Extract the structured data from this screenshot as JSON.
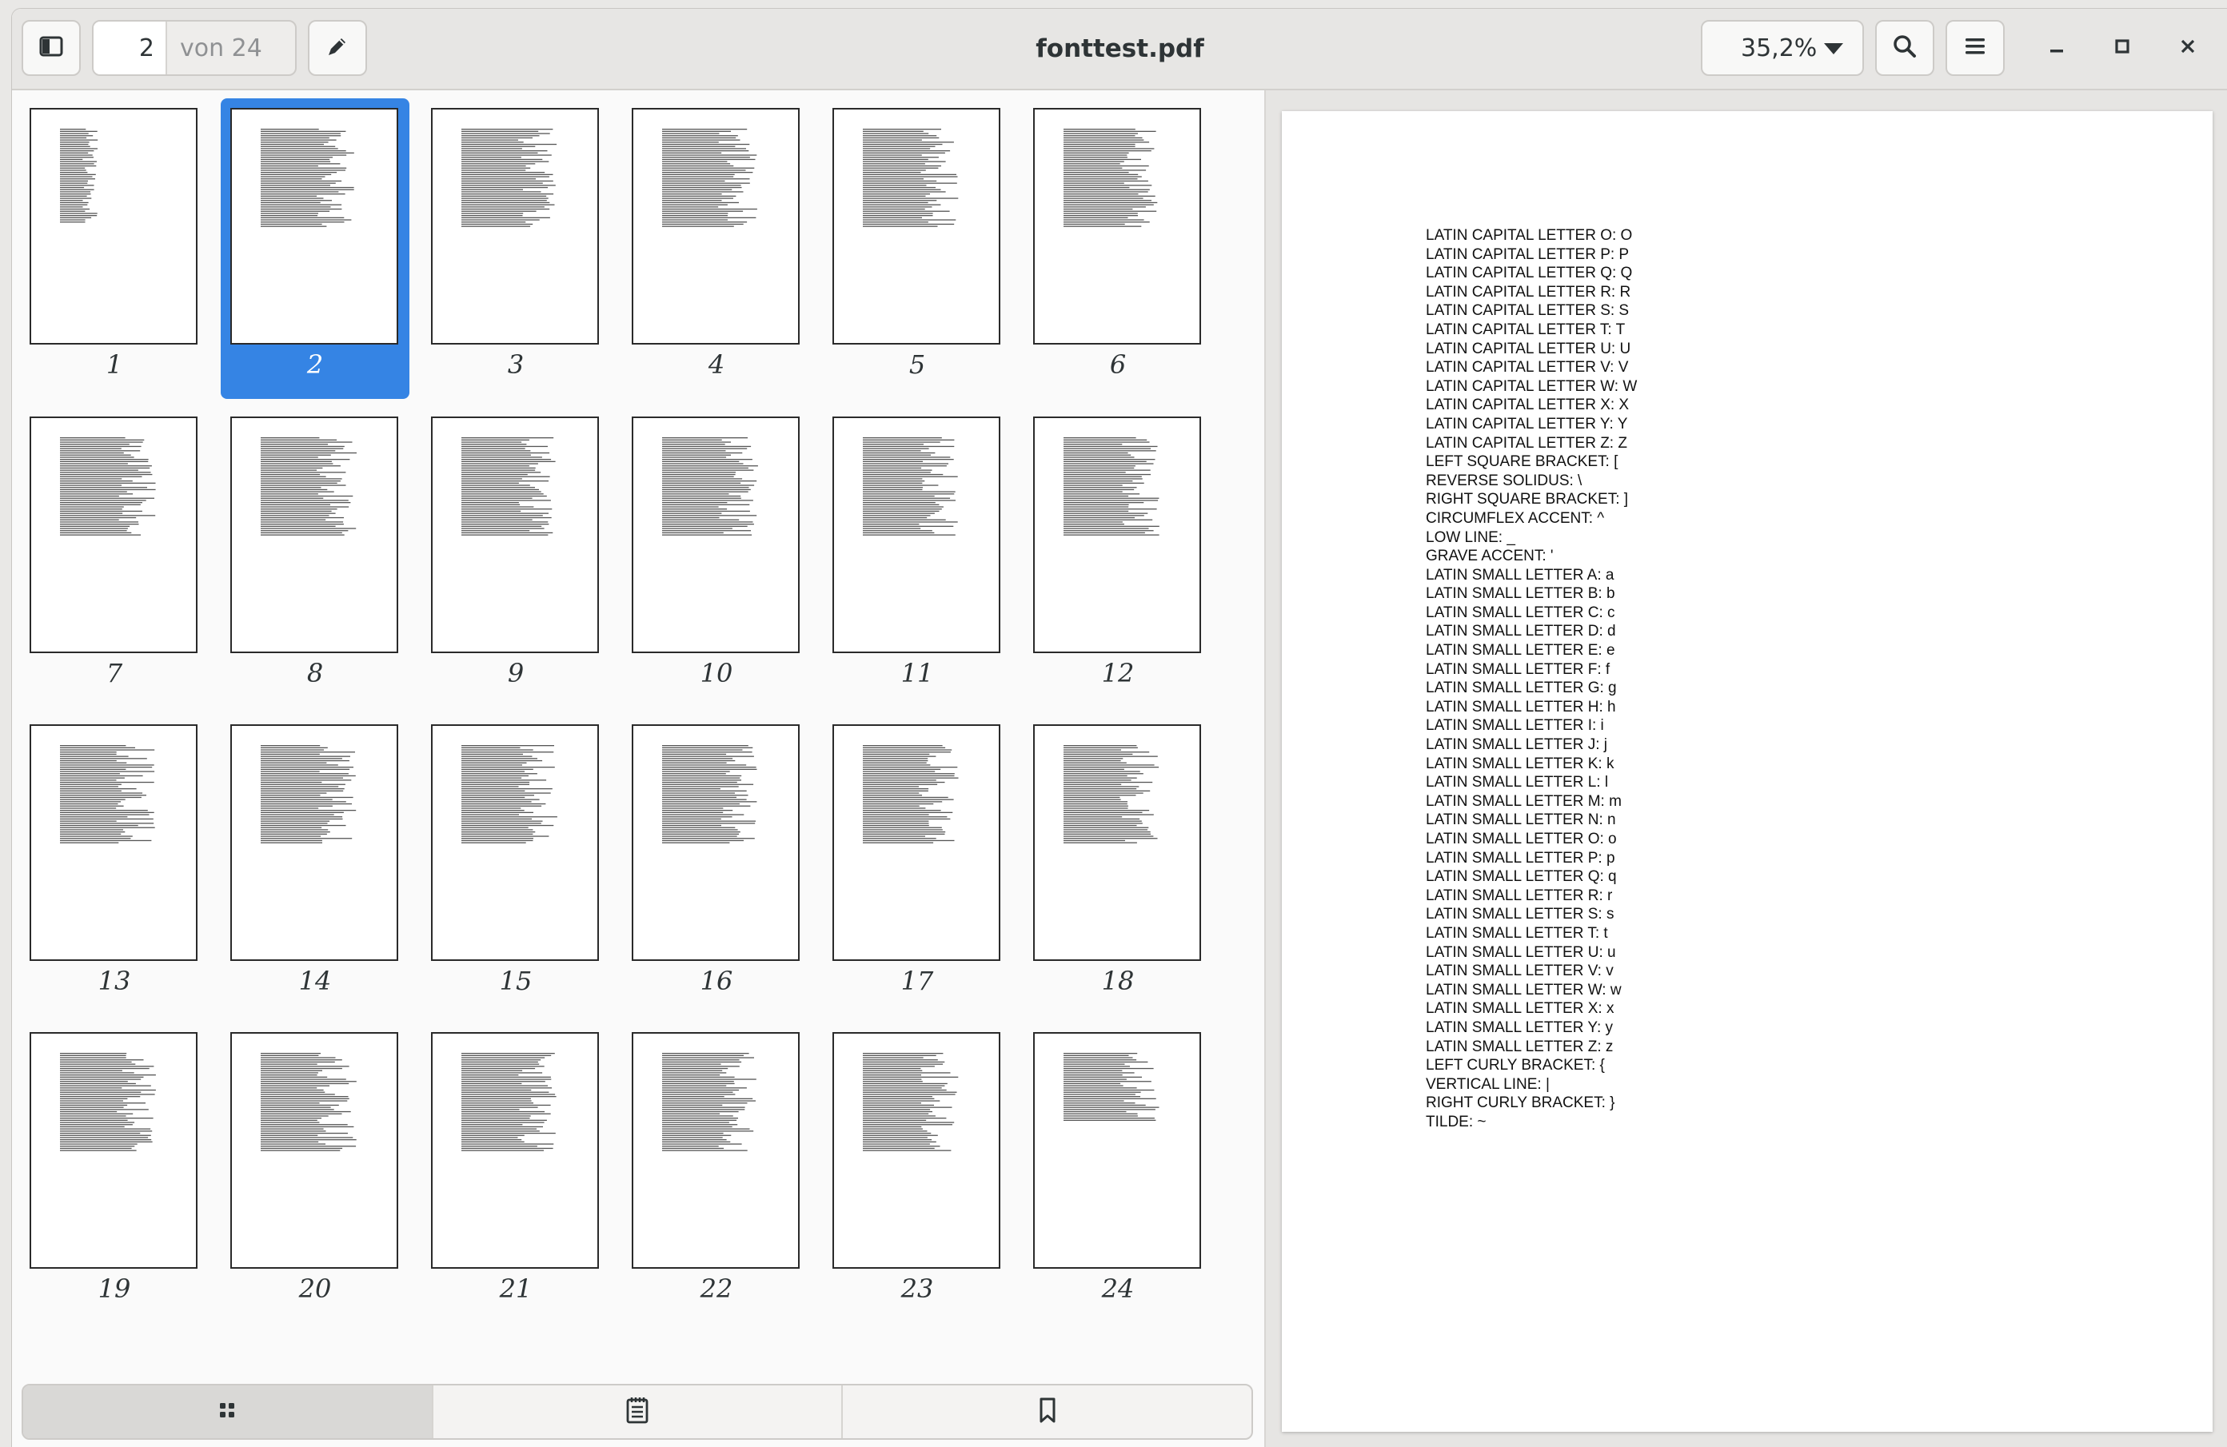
{
  "window": {
    "title": "fonttest.pdf"
  },
  "toolbar": {
    "sidebar_toggle_icon": "sidebar-icon",
    "page_number": "2",
    "page_total_label": "von 24",
    "annotate_icon": "pencil-icon",
    "zoom_label": "35,2%",
    "search_icon": "search-icon",
    "menu_icon": "hamburger-menu-icon"
  },
  "window_controls": {
    "minimize_icon": "minimize-icon",
    "maximize_icon": "maximize-icon",
    "close_icon": "close-icon"
  },
  "sidebar": {
    "selected_page": 2,
    "thumbnails": [
      "1",
      "2",
      "3",
      "4",
      "5",
      "6",
      "7",
      "8",
      "9",
      "10",
      "11",
      "12",
      "13",
      "14",
      "15",
      "16",
      "17",
      "18",
      "19",
      "20",
      "21",
      "22",
      "23",
      "24"
    ],
    "tabs": [
      {
        "icon": "thumbnails-grid-icon",
        "active": true
      },
      {
        "icon": "outline-icon",
        "active": false
      },
      {
        "icon": "bookmark-icon",
        "active": false
      }
    ]
  },
  "colors": {
    "accent": "#3584e4",
    "headerbar": "#e7e6e4"
  },
  "document": {
    "lines": [
      "LATIN CAPITAL LETTER O: O",
      "LATIN CAPITAL LETTER P: P",
      "LATIN CAPITAL LETTER Q: Q",
      "LATIN CAPITAL LETTER R: R",
      "LATIN CAPITAL LETTER S: S",
      "LATIN CAPITAL LETTER T: T",
      "LATIN CAPITAL LETTER U: U",
      "LATIN CAPITAL LETTER V: V",
      "LATIN CAPITAL LETTER W: W",
      "LATIN CAPITAL LETTER X: X",
      "LATIN CAPITAL LETTER Y: Y",
      "LATIN CAPITAL LETTER Z: Z",
      "LEFT SQUARE BRACKET: [",
      "REVERSE SOLIDUS: \\",
      "RIGHT SQUARE BRACKET: ]",
      "CIRCUMFLEX ACCENT: ^",
      "LOW LINE: _",
      "GRAVE ACCENT: '",
      "LATIN SMALL LETTER A: a",
      "LATIN SMALL LETTER B: b",
      "LATIN SMALL LETTER C: c",
      "LATIN SMALL LETTER D: d",
      "LATIN SMALL LETTER E: e",
      "LATIN SMALL LETTER F: f",
      "LATIN SMALL LETTER G: g",
      "LATIN SMALL LETTER H: h",
      "LATIN SMALL LETTER I: i",
      "LATIN SMALL LETTER J: j",
      "LATIN SMALL LETTER K: k",
      "LATIN SMALL LETTER L: l",
      "LATIN SMALL LETTER M: m",
      "LATIN SMALL LETTER N: n",
      "LATIN SMALL LETTER O: o",
      "LATIN SMALL LETTER P: p",
      "LATIN SMALL LETTER Q: q",
      "LATIN SMALL LETTER R: r",
      "LATIN SMALL LETTER S: s",
      "LATIN SMALL LETTER T: t",
      "LATIN SMALL LETTER U: u",
      "LATIN SMALL LETTER V: v",
      "LATIN SMALL LETTER W: w",
      "LATIN SMALL LETTER X: x",
      "LATIN SMALL LETTER Y: y",
      "LATIN SMALL LETTER Z: z",
      "LEFT CURLY BRACKET: {",
      "VERTICAL LINE: |",
      "RIGHT CURLY BRACKET: }",
      "TILDE: ~"
    ]
  }
}
